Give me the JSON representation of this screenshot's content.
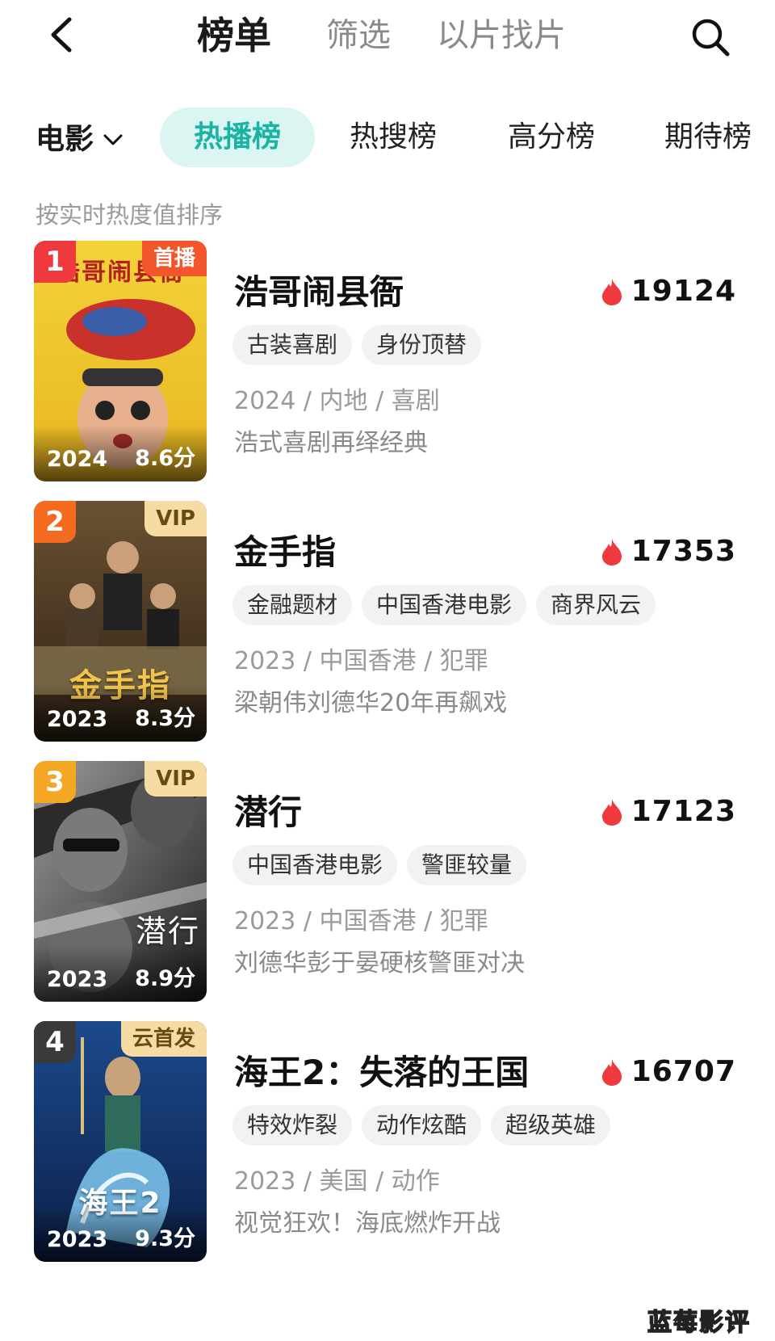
{
  "nav": {
    "tabs": [
      "榜单",
      "筛选",
      "以片找片"
    ]
  },
  "filter": {
    "category": "电影",
    "rank_tabs": [
      "热播榜",
      "热搜榜",
      "高分榜",
      "期待榜"
    ]
  },
  "sort_note": "按实时热度值排序",
  "items": [
    {
      "rank": "1",
      "badge": "首播",
      "poster_text": "浩哥闹县衙",
      "poster_year": "2024",
      "poster_score": "8.6分",
      "title": "浩哥闹县衙",
      "heat": "19124",
      "tags": [
        "古装喜剧",
        "身份顶替"
      ],
      "meta": "2024 / 内地 / 喜剧",
      "desc": "浩式喜剧再绎经典"
    },
    {
      "rank": "2",
      "badge": "VIP",
      "poster_text": "金手指",
      "poster_year": "2023",
      "poster_score": "8.3分",
      "title": "金手指",
      "heat": "17353",
      "tags": [
        "金融题材",
        "中国香港电影",
        "商界风云"
      ],
      "meta": "2023 / 中国香港 / 犯罪",
      "desc": "梁朝伟刘德华20年再飙戏"
    },
    {
      "rank": "3",
      "badge": "VIP",
      "poster_text": "潜行",
      "poster_year": "2023",
      "poster_score": "8.9分",
      "title": "潜行",
      "heat": "17123",
      "tags": [
        "中国香港电影",
        "警匪较量"
      ],
      "meta": "2023 / 中国香港 / 犯罪",
      "desc": "刘德华彭于晏硬核警匪对决"
    },
    {
      "rank": "4",
      "badge": "云首发",
      "poster_text": "海王2",
      "poster_year": "2023",
      "poster_score": "9.3分",
      "title": "海王2：失落的王国",
      "heat": "16707",
      "tags": [
        "特效炸裂",
        "动作炫酷",
        "超级英雄"
      ],
      "meta": "2023 / 美国 / 动作",
      "desc": "视觉狂欢！海底燃炸开战"
    }
  ],
  "watermark": "蓝莓影评",
  "colors": {
    "accent": "#19b4a3",
    "accent_bg": "#dbf5f2",
    "rank1": "#f0393f",
    "rank2": "#f56a1e",
    "rank3": "#f5a623",
    "rank4": "#3a3a3a",
    "heat_icon": "#f0393f"
  },
  "icons": [
    "back-arrow-icon",
    "search-icon",
    "chevron-down-icon",
    "flame-icon"
  ]
}
